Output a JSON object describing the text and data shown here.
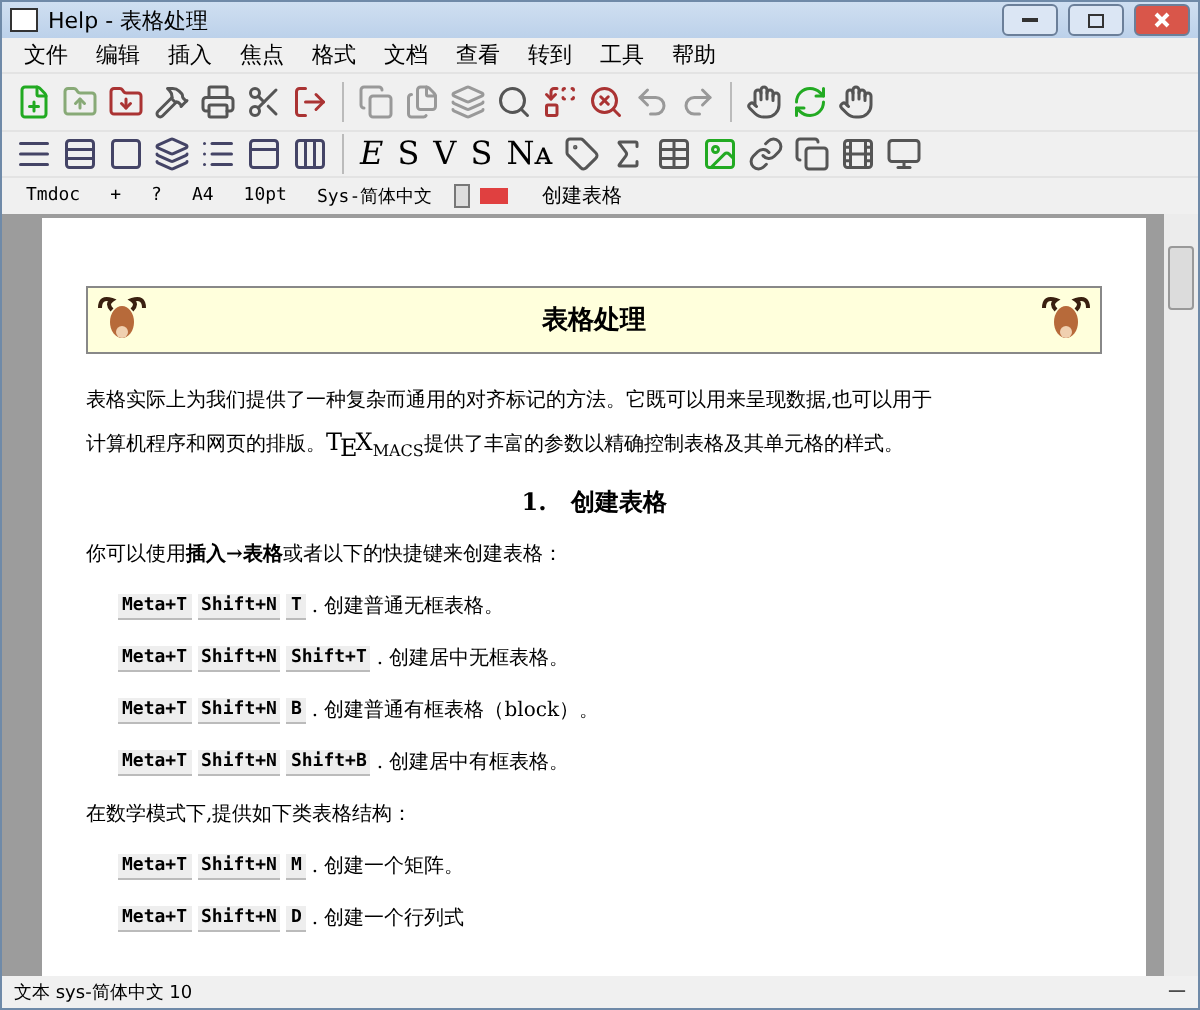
{
  "window": {
    "title": "Help - 表格处理"
  },
  "menu": [
    "文件",
    "编辑",
    "插入",
    "焦点",
    "格式",
    "文档",
    "查看",
    "转到",
    "工具",
    "帮助"
  ],
  "text_style_buttons": [
    "E",
    "S",
    "V",
    "S",
    "Nᴀ"
  ],
  "format_bar": {
    "style": "Tmdoc",
    "add": "+",
    "help": "?",
    "paper": "A4",
    "size": "10pt",
    "font": "Sys-简体中文",
    "context": "创建表格"
  },
  "document": {
    "title": "表格处理",
    "intro_1": "表格实际上为我们提供了一种复杂而通用的对齐标记的方法。它既可以用来呈现数据,也可以用于",
    "intro_2a": "计算机程序和网页的排版。",
    "logo": [
      "T",
      "E",
      "X",
      "MACS"
    ],
    "intro_2b": "提供了丰富的参数以精确控制表格及其单元格的样式。",
    "section": {
      "number": "1.",
      "title": "创建表格"
    },
    "lead": "你可以使用**插入→表格**或者以下的快捷键来创建表格：",
    "shortcuts": [
      {
        "keys": [
          "Meta+T",
          "Shift+N",
          "T"
        ],
        "text": ". 创建普通无框表格。"
      },
      {
        "keys": [
          "Meta+T",
          "Shift+N",
          "Shift+T"
        ],
        "text": ". 创建居中无框表格。"
      },
      {
        "keys": [
          "Meta+T",
          "Shift+N",
          "B"
        ],
        "text": ". 创建普通有框表格（block）。"
      },
      {
        "keys": [
          "Meta+T",
          "Shift+N",
          "Shift+B"
        ],
        "text": ". 创建居中有框表格。"
      }
    ],
    "math_lead": "在数学模式下,提供如下类表格结构：",
    "math_shortcuts": [
      {
        "keys": [
          "Meta+T",
          "Shift+N",
          "M"
        ],
        "text": ". 创建一个矩阵。"
      },
      {
        "keys": [
          "Meta+T",
          "Shift+N",
          "D"
        ],
        "text": ". 创建一个行列式"
      }
    ]
  },
  "status_bar": {
    "text": "文本 sys-简体中文 10",
    "right": "—"
  }
}
